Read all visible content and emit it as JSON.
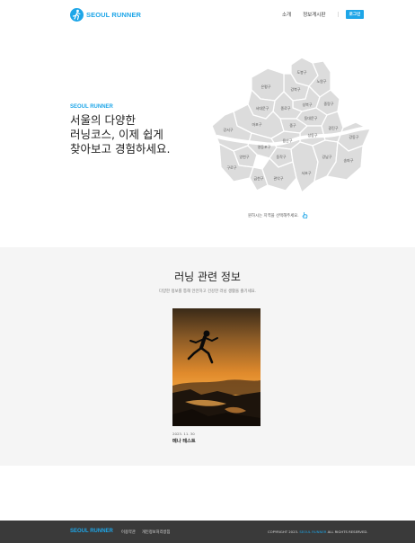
{
  "header": {
    "brand": "SEOUL RUNNER",
    "nav": {
      "intro": "소개",
      "board": "정보게시판"
    },
    "login": "로그인"
  },
  "hero": {
    "brand": "SEOUL RUNNER",
    "title_lines": [
      "서울의 다양한",
      "러닝코스, 이제 쉽게",
      "찾아보고 경험하세요."
    ],
    "map_hint": "원하시는 지역을 선택해주세요.",
    "districts": [
      "도봉구",
      "노원구",
      "강북구",
      "은평구",
      "성북구",
      "중랑구",
      "종로구",
      "서대문구",
      "동대문구",
      "중구",
      "마포구",
      "성동구",
      "광진구",
      "용산구",
      "강서구",
      "양천구",
      "영등포구",
      "동작구",
      "강동구",
      "구로구",
      "금천구",
      "관악구",
      "서초구",
      "강남구",
      "송파구"
    ]
  },
  "info": {
    "title": "러닝 관련 정보",
    "subtitle": "다양한 정보를 통해 안전하고 건강한 러닝 생활을 즐기세요.",
    "card": {
      "date": "2023. 11. 30",
      "title": "메나 테스트"
    }
  },
  "footer": {
    "brand": "SEOUL RUNNER",
    "links": {
      "terms": "이용약관",
      "privacy": "개인정보처리방침"
    },
    "copy_prefix": "COPYRIGHT 2023.",
    "copy_brand": "SEOUL RUNNER",
    "copy_suffix": "ALL RIGHTS RESERVED."
  },
  "colors": {
    "accent": "#1ea6e8",
    "map_fill": "#dcdcdc",
    "footer_bg": "#3a3a3a"
  }
}
